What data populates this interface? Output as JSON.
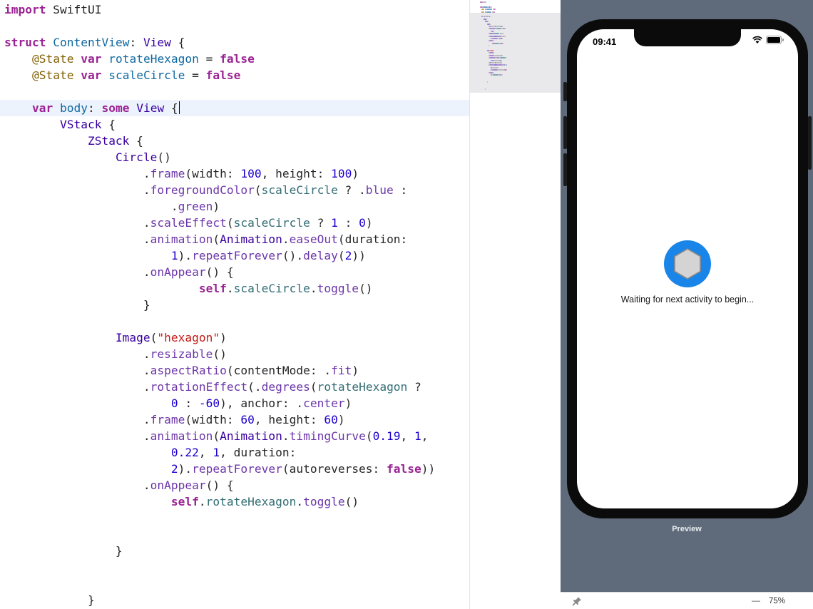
{
  "editor": {
    "lines": [
      [
        {
          "t": "import",
          "c": "kw"
        },
        {
          "t": " SwiftUI",
          "c": "pl"
        }
      ],
      [],
      [
        {
          "t": "struct",
          "c": "kw"
        },
        {
          "t": " ",
          "c": "pl"
        },
        {
          "t": "ContentView",
          "c": "decl"
        },
        {
          "t": ": ",
          "c": "pl"
        },
        {
          "t": "View",
          "c": "type"
        },
        {
          "t": " {",
          "c": "pl"
        }
      ],
      [
        {
          "t": "    ",
          "c": "pl"
        },
        {
          "t": "@State",
          "c": "attr"
        },
        {
          "t": " ",
          "c": "pl"
        },
        {
          "t": "var",
          "c": "kw"
        },
        {
          "t": " ",
          "c": "pl"
        },
        {
          "t": "rotateHexagon",
          "c": "decl"
        },
        {
          "t": " = ",
          "c": "pl"
        },
        {
          "t": "false",
          "c": "kw"
        }
      ],
      [
        {
          "t": "    ",
          "c": "pl"
        },
        {
          "t": "@State",
          "c": "attr"
        },
        {
          "t": " ",
          "c": "pl"
        },
        {
          "t": "var",
          "c": "kw"
        },
        {
          "t": " ",
          "c": "pl"
        },
        {
          "t": "scaleCircle",
          "c": "decl"
        },
        {
          "t": " = ",
          "c": "pl"
        },
        {
          "t": "false",
          "c": "kw"
        }
      ],
      [],
      [
        {
          "t": "    ",
          "c": "pl"
        },
        {
          "t": "var",
          "c": "kw"
        },
        {
          "t": " ",
          "c": "pl"
        },
        {
          "t": "body",
          "c": "decl"
        },
        {
          "t": ": ",
          "c": "pl"
        },
        {
          "t": "some",
          "c": "kw"
        },
        {
          "t": " ",
          "c": "pl"
        },
        {
          "t": "View",
          "c": "type"
        },
        {
          "t": " {",
          "c": "pl"
        }
      ],
      [
        {
          "t": "        ",
          "c": "pl"
        },
        {
          "t": "VStack",
          "c": "type"
        },
        {
          "t": " {",
          "c": "pl"
        }
      ],
      [
        {
          "t": "            ",
          "c": "pl"
        },
        {
          "t": "ZStack",
          "c": "type"
        },
        {
          "t": " {",
          "c": "pl"
        }
      ],
      [
        {
          "t": "                ",
          "c": "pl"
        },
        {
          "t": "Circle",
          "c": "type"
        },
        {
          "t": "()",
          "c": "pl"
        }
      ],
      [
        {
          "t": "                    .",
          "c": "pl"
        },
        {
          "t": "frame",
          "c": "meth"
        },
        {
          "t": "(width: ",
          "c": "pl"
        },
        {
          "t": "100",
          "c": "num"
        },
        {
          "t": ", height: ",
          "c": "pl"
        },
        {
          "t": "100",
          "c": "num"
        },
        {
          "t": ")",
          "c": "pl"
        }
      ],
      [
        {
          "t": "                    .",
          "c": "pl"
        },
        {
          "t": "foregroundColor",
          "c": "meth"
        },
        {
          "t": "(",
          "c": "pl"
        },
        {
          "t": "scaleCircle",
          "c": "prop"
        },
        {
          "t": " ? .",
          "c": "pl"
        },
        {
          "t": "blue",
          "c": "meth"
        },
        {
          "t": " :",
          "c": "pl"
        }
      ],
      [
        {
          "t": "                        .",
          "c": "pl"
        },
        {
          "t": "green",
          "c": "meth"
        },
        {
          "t": ")",
          "c": "pl"
        }
      ],
      [
        {
          "t": "                    .",
          "c": "pl"
        },
        {
          "t": "scaleEffect",
          "c": "meth"
        },
        {
          "t": "(",
          "c": "pl"
        },
        {
          "t": "scaleCircle",
          "c": "prop"
        },
        {
          "t": " ? ",
          "c": "pl"
        },
        {
          "t": "1",
          "c": "num"
        },
        {
          "t": " : ",
          "c": "pl"
        },
        {
          "t": "0",
          "c": "num"
        },
        {
          "t": ")",
          "c": "pl"
        }
      ],
      [
        {
          "t": "                    .",
          "c": "pl"
        },
        {
          "t": "animation",
          "c": "meth"
        },
        {
          "t": "(",
          "c": "pl"
        },
        {
          "t": "Animation",
          "c": "type"
        },
        {
          "t": ".",
          "c": "pl"
        },
        {
          "t": "easeOut",
          "c": "meth"
        },
        {
          "t": "(duration:",
          "c": "pl"
        }
      ],
      [
        {
          "t": "                        ",
          "c": "pl"
        },
        {
          "t": "1",
          "c": "num"
        },
        {
          "t": ").",
          "c": "pl"
        },
        {
          "t": "repeatForever",
          "c": "meth"
        },
        {
          "t": "().",
          "c": "pl"
        },
        {
          "t": "delay",
          "c": "meth"
        },
        {
          "t": "(",
          "c": "pl"
        },
        {
          "t": "2",
          "c": "num"
        },
        {
          "t": "))",
          "c": "pl"
        }
      ],
      [
        {
          "t": "                    .",
          "c": "pl"
        },
        {
          "t": "onAppear",
          "c": "meth"
        },
        {
          "t": "() {",
          "c": "pl"
        }
      ],
      [
        {
          "t": "                            ",
          "c": "pl"
        },
        {
          "t": "self",
          "c": "kw"
        },
        {
          "t": ".",
          "c": "pl"
        },
        {
          "t": "scaleCircle",
          "c": "prop"
        },
        {
          "t": ".",
          "c": "pl"
        },
        {
          "t": "toggle",
          "c": "meth"
        },
        {
          "t": "()",
          "c": "pl"
        }
      ],
      [
        {
          "t": "                    }",
          "c": "pl"
        }
      ],
      [],
      [
        {
          "t": "                ",
          "c": "pl"
        },
        {
          "t": "Image",
          "c": "type"
        },
        {
          "t": "(",
          "c": "pl"
        },
        {
          "t": "\"hexagon\"",
          "c": "str"
        },
        {
          "t": ")",
          "c": "pl"
        }
      ],
      [
        {
          "t": "                    .",
          "c": "pl"
        },
        {
          "t": "resizable",
          "c": "meth"
        },
        {
          "t": "()",
          "c": "pl"
        }
      ],
      [
        {
          "t": "                    .",
          "c": "pl"
        },
        {
          "t": "aspectRatio",
          "c": "meth"
        },
        {
          "t": "(contentMode: .",
          "c": "pl"
        },
        {
          "t": "fit",
          "c": "meth"
        },
        {
          "t": ")",
          "c": "pl"
        }
      ],
      [
        {
          "t": "                    .",
          "c": "pl"
        },
        {
          "t": "rotationEffect",
          "c": "meth"
        },
        {
          "t": "(.",
          "c": "pl"
        },
        {
          "t": "degrees",
          "c": "meth"
        },
        {
          "t": "(",
          "c": "pl"
        },
        {
          "t": "rotateHexagon",
          "c": "prop"
        },
        {
          "t": " ?",
          "c": "pl"
        }
      ],
      [
        {
          "t": "                        ",
          "c": "pl"
        },
        {
          "t": "0",
          "c": "num"
        },
        {
          "t": " : ",
          "c": "pl"
        },
        {
          "t": "-60",
          "c": "num"
        },
        {
          "t": "), anchor: .",
          "c": "pl"
        },
        {
          "t": "center",
          "c": "meth"
        },
        {
          "t": ")",
          "c": "pl"
        }
      ],
      [
        {
          "t": "                    .",
          "c": "pl"
        },
        {
          "t": "frame",
          "c": "meth"
        },
        {
          "t": "(width: ",
          "c": "pl"
        },
        {
          "t": "60",
          "c": "num"
        },
        {
          "t": ", height: ",
          "c": "pl"
        },
        {
          "t": "60",
          "c": "num"
        },
        {
          "t": ")",
          "c": "pl"
        }
      ],
      [
        {
          "t": "                    .",
          "c": "pl"
        },
        {
          "t": "animation",
          "c": "meth"
        },
        {
          "t": "(",
          "c": "pl"
        },
        {
          "t": "Animation",
          "c": "type"
        },
        {
          "t": ".",
          "c": "pl"
        },
        {
          "t": "timingCurve",
          "c": "meth"
        },
        {
          "t": "(",
          "c": "pl"
        },
        {
          "t": "0.19",
          "c": "num"
        },
        {
          "t": ", ",
          "c": "pl"
        },
        {
          "t": "1",
          "c": "num"
        },
        {
          "t": ",",
          "c": "pl"
        }
      ],
      [
        {
          "t": "                        ",
          "c": "pl"
        },
        {
          "t": "0.22",
          "c": "num"
        },
        {
          "t": ", ",
          "c": "pl"
        },
        {
          "t": "1",
          "c": "num"
        },
        {
          "t": ", duration:",
          "c": "pl"
        }
      ],
      [
        {
          "t": "                        ",
          "c": "pl"
        },
        {
          "t": "2",
          "c": "num"
        },
        {
          "t": ").",
          "c": "pl"
        },
        {
          "t": "repeatForever",
          "c": "meth"
        },
        {
          "t": "(autoreverses: ",
          "c": "pl"
        },
        {
          "t": "false",
          "c": "kw"
        },
        {
          "t": "))",
          "c": "pl"
        }
      ],
      [
        {
          "t": "                    .",
          "c": "pl"
        },
        {
          "t": "onAppear",
          "c": "meth"
        },
        {
          "t": "() {",
          "c": "pl"
        }
      ],
      [
        {
          "t": "                        ",
          "c": "pl"
        },
        {
          "t": "self",
          "c": "kw"
        },
        {
          "t": ".",
          "c": "pl"
        },
        {
          "t": "rotateHexagon",
          "c": "prop"
        },
        {
          "t": ".",
          "c": "pl"
        },
        {
          "t": "toggle",
          "c": "meth"
        },
        {
          "t": "()",
          "c": "pl"
        }
      ],
      [],
      [],
      [
        {
          "t": "                }",
          "c": "pl"
        }
      ],
      [],
      [],
      [
        {
          "t": "            }",
          "c": "pl"
        }
      ]
    ],
    "current_line": 6
  },
  "preview": {
    "status_time": "09:41",
    "circle_color": "#1a85e8",
    "hexagon_fill": "#d4d4d4",
    "waiting_text": "Waiting for next activity to begin...",
    "label": "Preview",
    "canvas_color": "#5f6b7b"
  },
  "bottom_bar": {
    "zoom_out_symbol": "—",
    "zoom_level": "75%"
  }
}
